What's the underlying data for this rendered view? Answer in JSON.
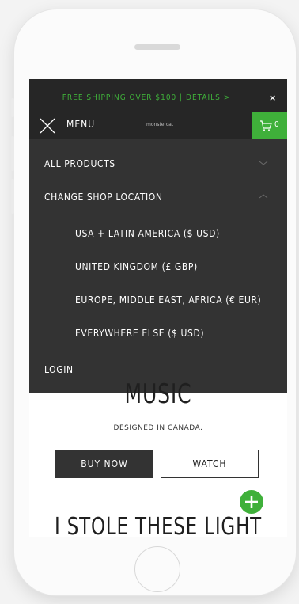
{
  "promo": {
    "text": "FREE SHIPPING OVER $100 | DETAILS >",
    "close": "×"
  },
  "header": {
    "menu_label": "MENU",
    "logo_text": "monstercat",
    "cart_count": "0"
  },
  "menu": {
    "all_products": "ALL PRODUCTS",
    "change_location": "CHANGE SHOP LOCATION",
    "locations": [
      "USA + LATIN AMERICA ($ USD)",
      "UNITED KINGDOM (£ GBP)",
      "EUROPE, MIDDLE EAST, AFRICA (€ EUR)",
      "EVERYWHERE ELSE ($ USD)"
    ],
    "login": "LOGIN"
  },
  "hero": {
    "title": "MUSIC",
    "subtitle": "DESIGNED IN CANADA.",
    "buy_label": "BUY NOW",
    "watch_label": "WATCH"
  },
  "next_section": {
    "title": "I STOLE THESE LIGHT"
  },
  "colors": {
    "accent": "#3fb03a",
    "header_bg": "#262626",
    "menu_bg": "#333333"
  },
  "icons": {
    "menu_close": "close-x-icon",
    "cart": "cart-icon",
    "expand": "chevron-down-icon",
    "collapse": "chevron-up-icon",
    "add": "plus-icon"
  }
}
